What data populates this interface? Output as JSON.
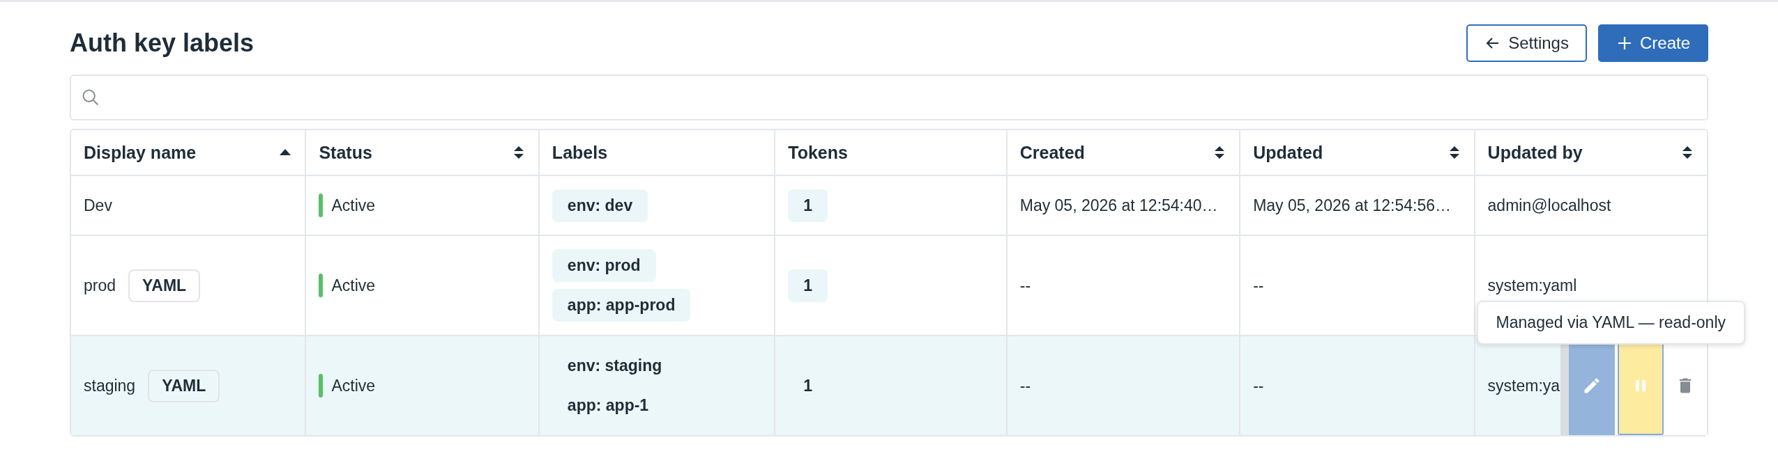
{
  "page": {
    "title": "Auth key labels"
  },
  "buttons": [
    {
      "kind": "back",
      "label": "Settings"
    },
    {
      "kind": "create",
      "label": "Create"
    }
  ],
  "table": {
    "columns": [
      {
        "label": "Display name",
        "sortable": true,
        "sorted": true
      },
      {
        "label": "Status",
        "sortable": true,
        "sorted": false
      },
      {
        "label": "Labels",
        "sortable": false
      },
      {
        "label": "Tokens",
        "sortable": false
      },
      {
        "label": "Created",
        "sortable": true,
        "sorted": false
      },
      {
        "label": "Updated",
        "sortable": true,
        "sorted": false
      },
      {
        "label": "Updated by",
        "sortable": true,
        "sorted": false
      }
    ],
    "rows": [
      {
        "name": "Dev",
        "status": {
          "label": "Active",
          "color": "#57c067"
        },
        "labels": [
          "env: dev"
        ],
        "tokens": "1",
        "created": "May 05, 2026 at 12:54:40…",
        "updated": "May 05, 2026 at 12:54:56…",
        "updated_by": "admin@localhost",
        "highlighted": false
      },
      {
        "name": "prod",
        "badge": "YAML",
        "status": {
          "label": "Active",
          "color": "#57c067"
        },
        "labels": [
          "env: prod",
          "app: app-prod"
        ],
        "tokens": "1",
        "created": "--",
        "updated": "--",
        "updated_by": "system:yaml",
        "highlighted": false
      },
      {
        "name": "staging",
        "badge": "YAML",
        "status": {
          "label": "Active",
          "color": "#57c067"
        },
        "labels": [
          "env: staging",
          "app: app-1"
        ],
        "tokens": "1",
        "created": "--",
        "updated": "--",
        "updated_by": "system:ya",
        "highlighted": true,
        "actions": [
          {
            "kind": "edit",
            "focused": false
          },
          {
            "kind": "pause",
            "focused": true
          },
          {
            "kind": "delete",
            "focused": false
          }
        ],
        "tooltip": "Managed via YAML — read-only"
      }
    ]
  }
}
